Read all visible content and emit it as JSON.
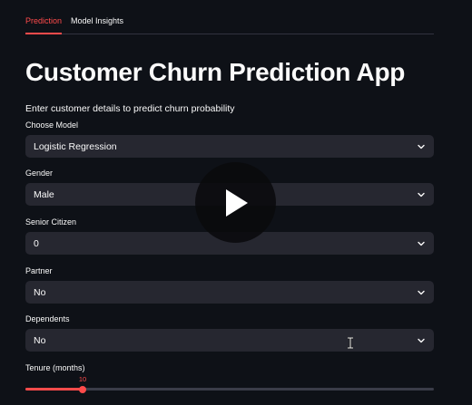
{
  "tabs": [
    {
      "label": "Prediction",
      "active": true
    },
    {
      "label": "Model Insights",
      "active": false
    }
  ],
  "header": {
    "title": "Customer Churn Prediction App",
    "subtitle": "Enter customer details to predict churn probability"
  },
  "form": {
    "model": {
      "label": "Choose Model",
      "value": "Logistic Regression"
    },
    "gender": {
      "label": "Gender",
      "value": "Male"
    },
    "senior_citizen": {
      "label": "Senior Citizen",
      "value": "0"
    },
    "partner": {
      "label": "Partner",
      "value": "No"
    },
    "dependents": {
      "label": "Dependents",
      "value": "No"
    },
    "tenure": {
      "label": "Tenure (months)",
      "value": "10",
      "fraction": 0.14
    }
  },
  "overlay": {
    "icon": "play-icon"
  },
  "colors": {
    "background": "#0e1117",
    "input_bg": "#262730",
    "accent": "#ff4b4b"
  }
}
